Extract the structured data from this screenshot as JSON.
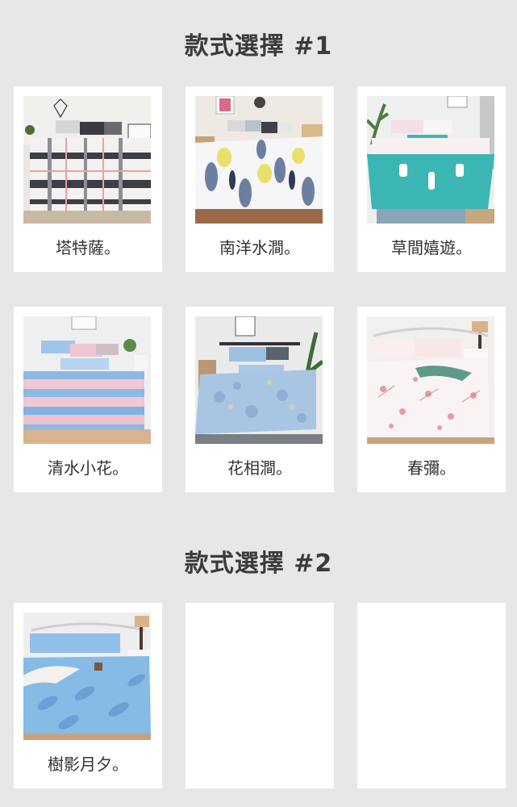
{
  "sections": [
    {
      "title": "款式選擇 #1",
      "items": [
        {
          "label": "塔特薩。",
          "image": "bedding-grey-plaid-photo"
        },
        {
          "label": "南洋水澗。",
          "image": "bedding-white-palm-leaf-photo"
        },
        {
          "label": "草間嬉遊。",
          "image": "bedding-teal-cactus-photo"
        },
        {
          "label": "清水小花。",
          "image": "bedding-pink-blue-stripe-photo"
        },
        {
          "label": "花相澗。",
          "image": "bedding-blue-floral-photo"
        },
        {
          "label": "春彌。",
          "image": "bedding-pink-blossom-photo"
        }
      ]
    },
    {
      "title": "款式選擇 #2",
      "items": [
        {
          "label": "樹影月夕。",
          "image": "bedding-blue-leaf-photo"
        },
        {
          "label": "",
          "image": ""
        },
        {
          "label": "",
          "image": ""
        }
      ]
    }
  ],
  "colors": {
    "background": "#e7e7e7",
    "card": "#ffffff",
    "title_text": "#3b3b3b",
    "caption_text": "#333333"
  }
}
